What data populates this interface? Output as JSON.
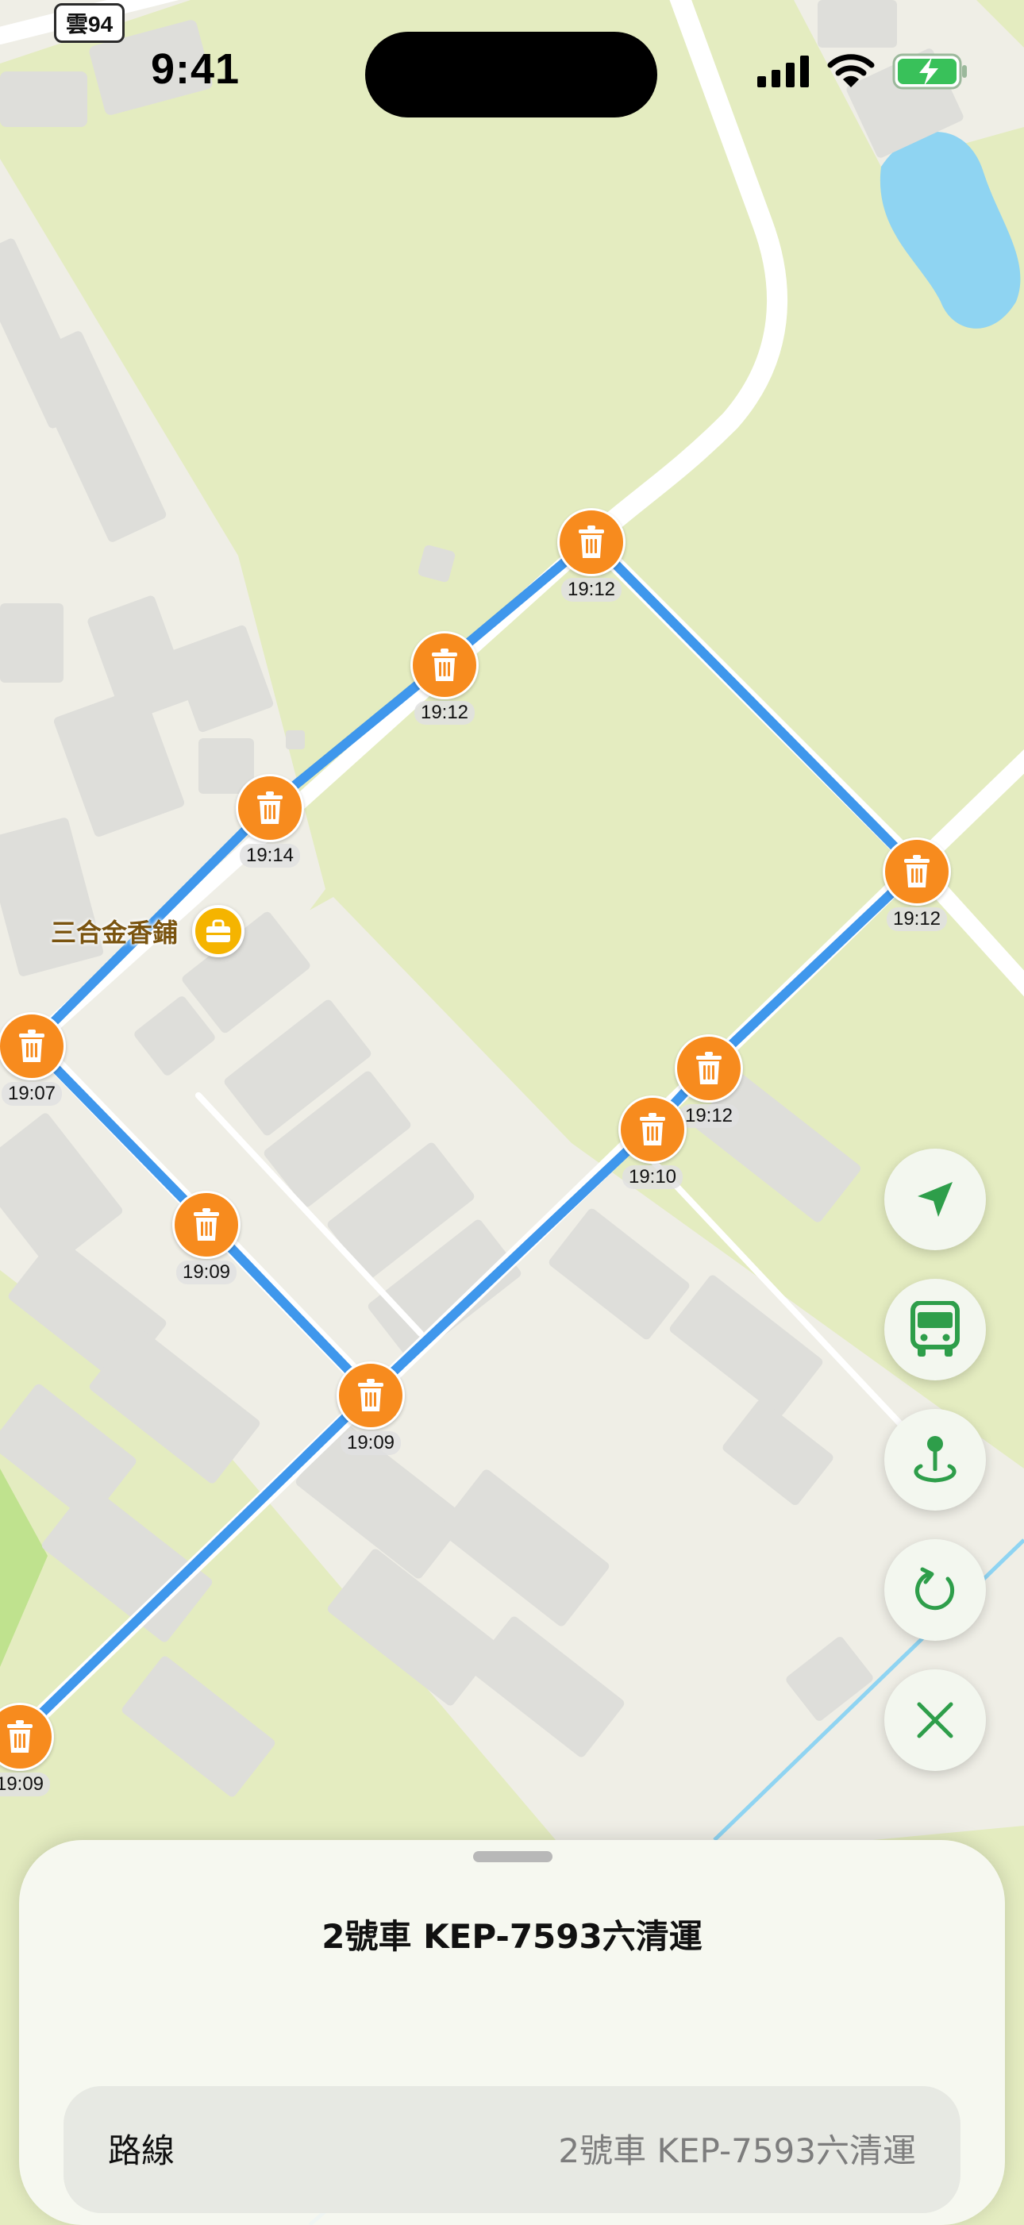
{
  "status_bar": {
    "time": "9:41"
  },
  "map": {
    "road_badge": "雲94",
    "poi": {
      "name": "三合金香鋪",
      "icon": "shop-bag-icon"
    },
    "route_color": "#3f97ec",
    "stop_color": "#f78b1e",
    "stops": [
      {
        "time": "19:12",
        "icon": "trash-icon"
      },
      {
        "time": "19:12",
        "icon": "trash-icon"
      },
      {
        "time": "19:14",
        "icon": "trash-icon"
      },
      {
        "time": "19:12",
        "icon": "trash-icon"
      },
      {
        "time": "19:07",
        "icon": "trash-icon"
      },
      {
        "time": "19:12",
        "icon": "trash-icon"
      },
      {
        "time": "19:10",
        "icon": "trash-icon"
      },
      {
        "time": "19:09",
        "icon": "trash-icon"
      },
      {
        "time": "19:09",
        "icon": "trash-icon"
      },
      {
        "time": "19:09",
        "icon": "trash-icon"
      }
    ]
  },
  "controls": [
    {
      "name": "locate-me",
      "icon": "location-arrow-icon"
    },
    {
      "name": "bus",
      "icon": "bus-icon"
    },
    {
      "name": "pin",
      "icon": "map-pin-icon"
    },
    {
      "name": "refresh",
      "icon": "refresh-icon"
    },
    {
      "name": "close",
      "icon": "close-icon"
    }
  ],
  "accent_color": "#2e9e4a",
  "sheet": {
    "title": "2號車 KEP-7593六清運",
    "route_label": "路線",
    "route_value": "2號車 KEP-7593六清運"
  }
}
